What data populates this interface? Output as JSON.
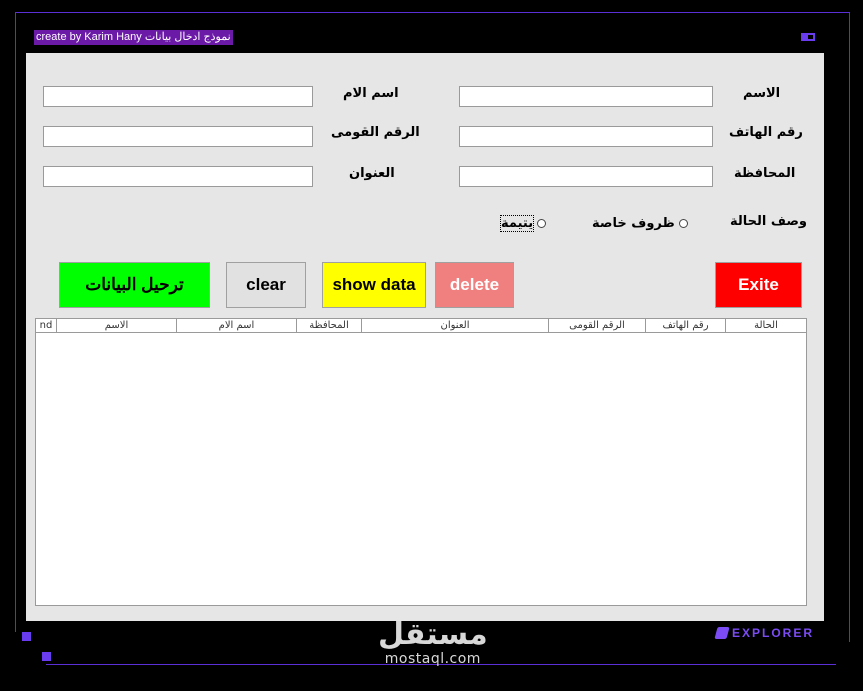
{
  "window": {
    "title": "create by Karim Hany نموذج ادخال بيانات"
  },
  "form": {
    "fields": {
      "name": {
        "label": "الاسم",
        "value": ""
      },
      "mother_name": {
        "label": "اسم الام",
        "value": ""
      },
      "phone": {
        "label": "رقم الهاتف",
        "value": ""
      },
      "national_id": {
        "label": "الرقم القومى",
        "value": ""
      },
      "governorate": {
        "label": "المحافظة",
        "value": ""
      },
      "address": {
        "label": "العنوان",
        "value": ""
      }
    },
    "case_description": {
      "label": "وصف الحالة",
      "options": [
        "ظروف خاصة",
        "يتيمة"
      ]
    }
  },
  "buttons": {
    "submit": "ترحيل البيانات",
    "clear": "clear",
    "show_data": "show data",
    "delete": "delete",
    "exit": "Exite"
  },
  "table": {
    "columns": [
      "nd",
      "الاسم",
      "اسم الام",
      "المحافظة",
      "العنوان",
      "الرقم القومى",
      "رقم الهاتف",
      "الحالة"
    ],
    "rows": []
  },
  "watermark": {
    "arabic": "مستقل",
    "latin": "mostaql.com"
  },
  "branding": {
    "explorer": "EXPLORER"
  },
  "colors": {
    "accent": "#6a3cf0",
    "title_bg": "#6b1aa8",
    "submit_bg": "#00ff00",
    "show_data_bg": "#ffff00",
    "delete_bg": "#f08080",
    "exit_bg": "#ff0000"
  }
}
